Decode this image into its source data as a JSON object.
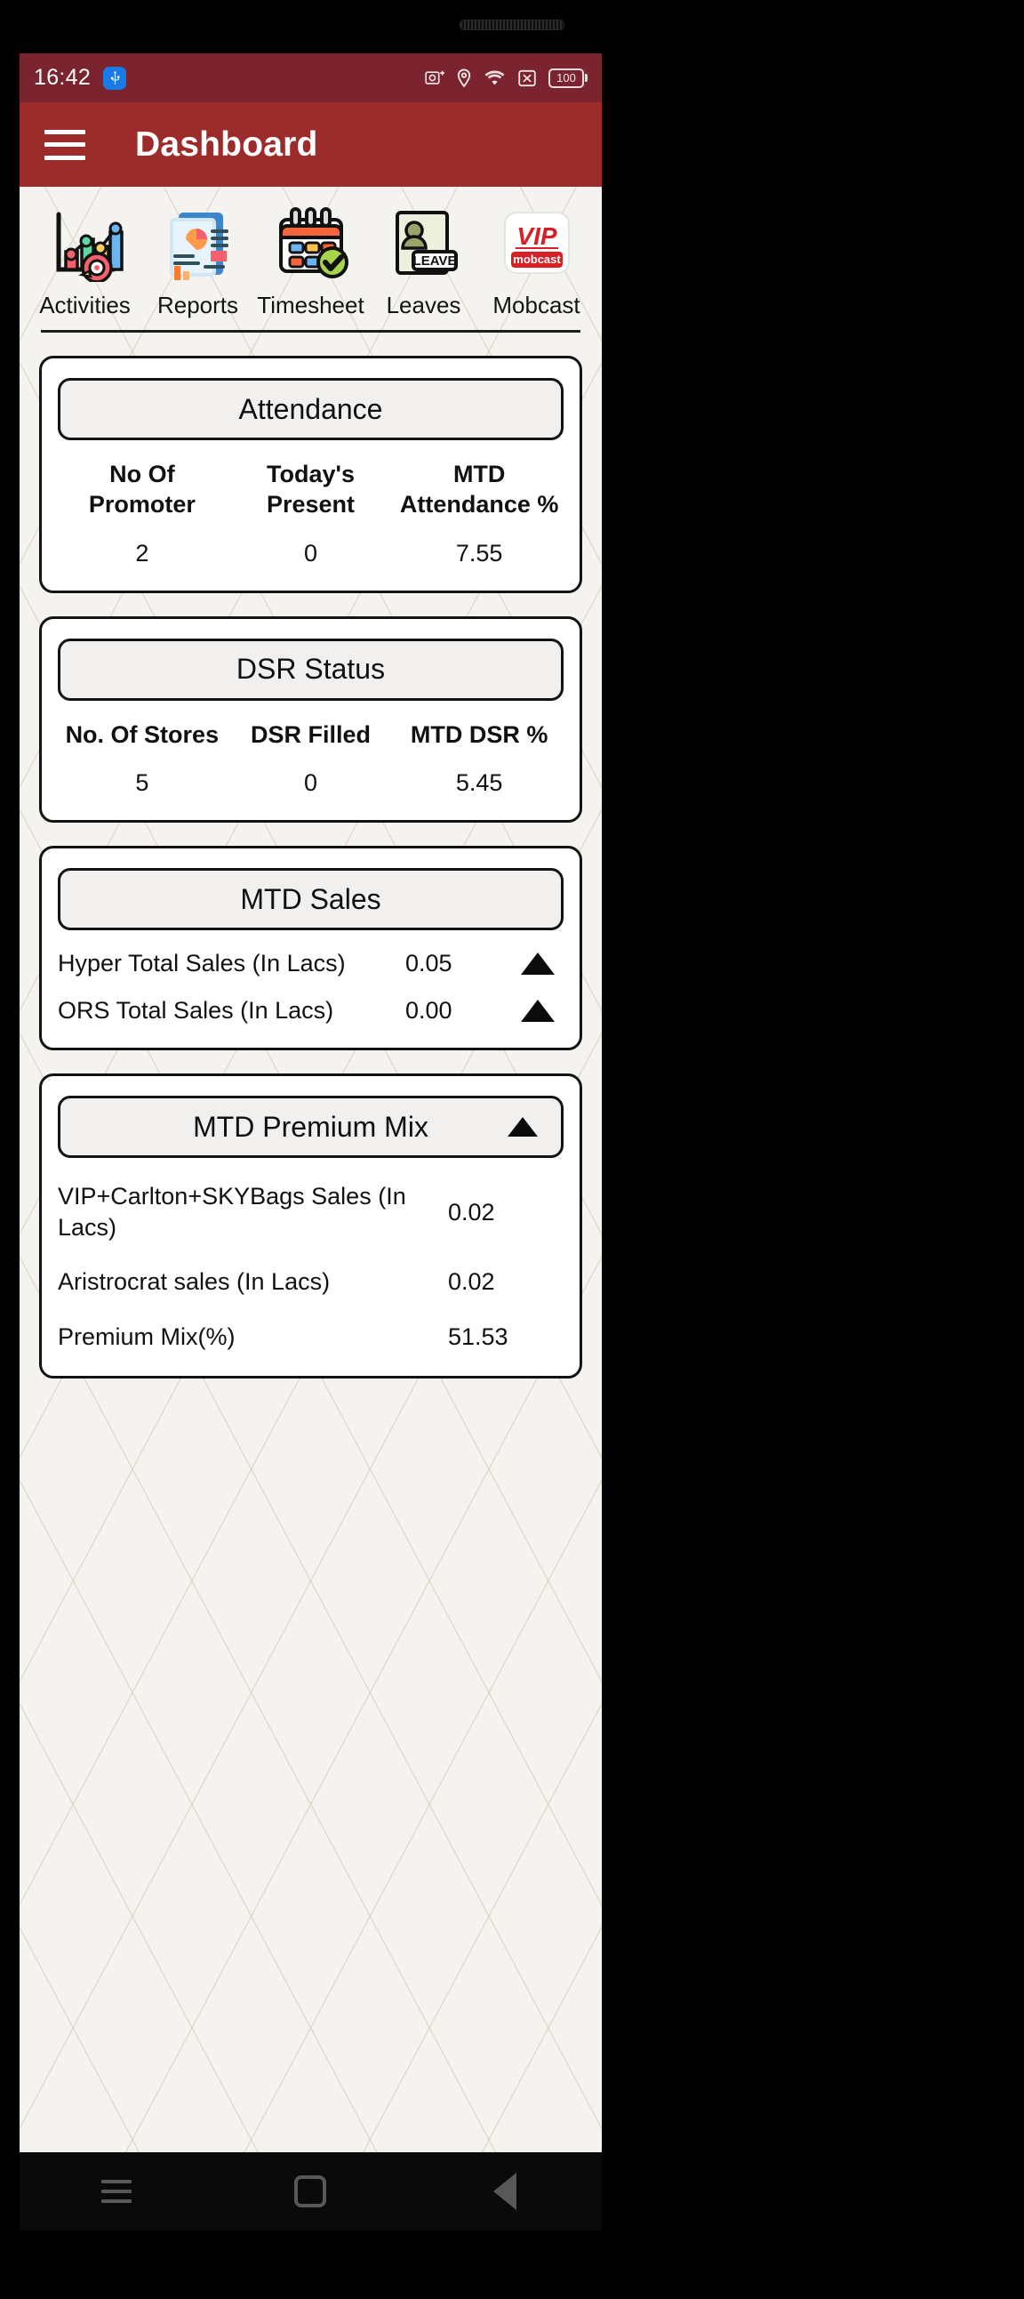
{
  "status_bar": {
    "time": "16:42",
    "usb_icon": "usb-icon",
    "icons": [
      "screenshot-icon",
      "location-icon",
      "wifi-icon",
      "no-sim-icon"
    ],
    "battery_level": "100"
  },
  "app_bar": {
    "menu_icon": "hamburger-menu-icon",
    "title": "Dashboard"
  },
  "quick_actions": [
    {
      "label": "Activities",
      "icon": "analytics-target-icon"
    },
    {
      "label": "Reports",
      "icon": "report-document-icon"
    },
    {
      "label": "Timesheet",
      "icon": "calendar-check-icon"
    },
    {
      "label": "Leaves",
      "icon": "leave-badge-icon"
    },
    {
      "label": "Mobcast",
      "icon": "vip-mobcast-logo-icon"
    }
  ],
  "cards": {
    "attendance": {
      "title": "Attendance",
      "columns": [
        "No Of Promoter",
        "Today's Present",
        "MTD Attendance %"
      ],
      "values": [
        "2",
        "0",
        "7.55"
      ]
    },
    "dsr_status": {
      "title": "DSR Status",
      "columns": [
        "No. Of Stores",
        "DSR Filled",
        "MTD DSR %"
      ],
      "values": [
        "5",
        "0",
        "5.45"
      ]
    },
    "mtd_sales": {
      "title": "MTD Sales",
      "rows": [
        {
          "label": "Hyper Total Sales (In Lacs)",
          "value": "0.05",
          "trend": "up-triangle-icon"
        },
        {
          "label": "ORS Total Sales (In Lacs)",
          "value": "0.00",
          "trend": "up-triangle-icon"
        }
      ]
    },
    "mtd_premium_mix": {
      "title": "MTD Premium Mix",
      "collapse_icon": "up-triangle-icon",
      "rows": [
        {
          "label": "VIP+Carlton+SKYBags Sales (In Lacs)",
          "value": "0.02"
        },
        {
          "label": "Aristrocrat sales (In Lacs)",
          "value": "0.02"
        },
        {
          "label": "Premium Mix(%)",
          "value": "51.53"
        }
      ]
    }
  },
  "nav_bar": {
    "recents": "recents-icon",
    "home": "home-icon",
    "back": "back-icon"
  },
  "colors": {
    "status_bar": "#7b2430",
    "app_bar": "#9c2b2b",
    "page_bg": "#f4f3f0",
    "card_bg": "#ffffff",
    "card_border": "#131313"
  },
  "brand": {
    "vip": "VIP",
    "mobcast": "mobcast",
    "leave": "LEAVE"
  }
}
